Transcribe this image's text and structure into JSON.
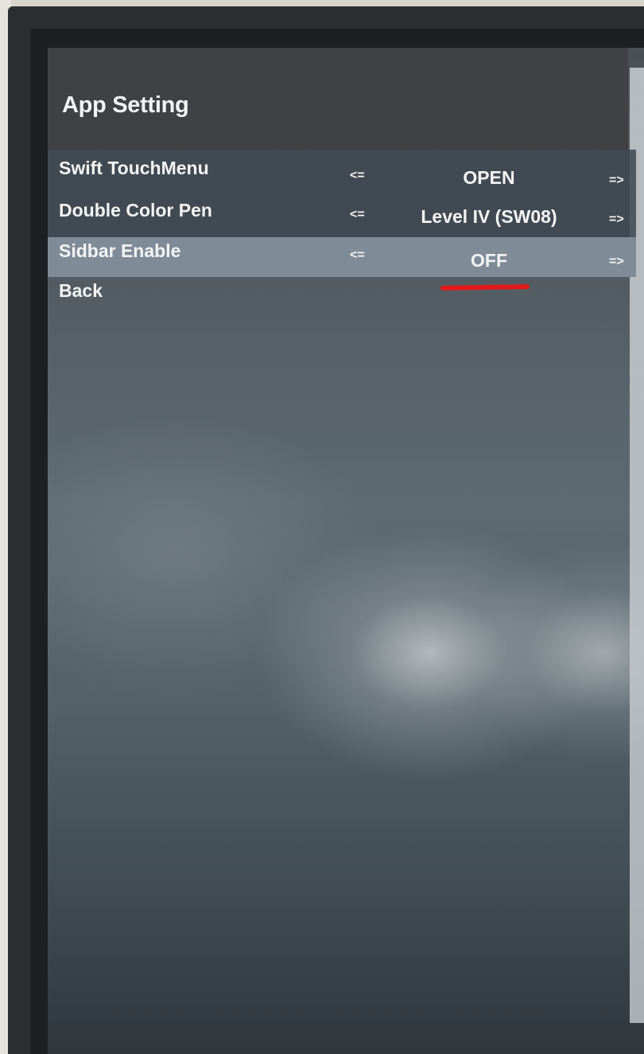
{
  "app": {
    "title": "App Setting"
  },
  "settings": [
    {
      "label": "Swift TouchMenu",
      "prev": "<=",
      "value": "OPEN",
      "next": "=>"
    },
    {
      "label": "Double Color Pen",
      "prev": "<=",
      "value": "Level IV (SW08)",
      "next": "=>"
    },
    {
      "label": "Sidbar Enable",
      "prev": "<=",
      "value": "OFF",
      "next": "=>",
      "selected": true
    }
  ],
  "back": {
    "label": "Back"
  },
  "colors": {
    "title_bar": "#3f4145",
    "selected_row": "#7f8c97",
    "text": "#f3f4f5",
    "annotation": "#e01a1a"
  }
}
